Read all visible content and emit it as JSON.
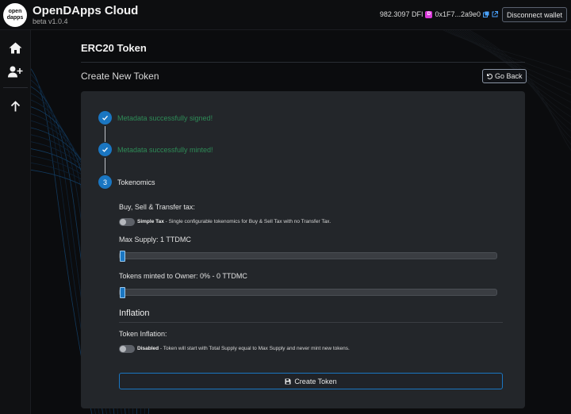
{
  "app": {
    "logo_text": "open dapps",
    "title": "OpenDApps Cloud",
    "version": "beta v1.0.4"
  },
  "wallet": {
    "balance": "982.3097 DFI",
    "dfi_icon": "dfi-token-icon",
    "address": "0x1F7...2a9e0",
    "disconnect_label": "Disconnect wallet"
  },
  "sidebar": {
    "items": [
      {
        "icon": "home-icon"
      },
      {
        "icon": "add-user-icon"
      },
      {
        "icon": "arrow-up-icon"
      }
    ]
  },
  "page": {
    "title": "ERC20 Token",
    "subtitle": "Create New Token",
    "go_back_label": "Go Back"
  },
  "steps": [
    {
      "label": "Metadata successfully signed!",
      "status": "done"
    },
    {
      "label": "Metadata successfully minted!",
      "status": "done"
    },
    {
      "number": "3",
      "label": "Tokenomics",
      "status": "active"
    }
  ],
  "tax": {
    "label": "Buy, Sell & Transfer tax:",
    "toggle_name": "Simple Tax",
    "toggle_desc": " - Single configurable tokenomics for Buy & Sell Tax with no Transfer Tax.",
    "enabled": false
  },
  "max_supply": {
    "label": "Max Supply:  1 TTDMC",
    "slider_fraction": 0
  },
  "owner_mint": {
    "label": "Tokens minted to Owner:  0% - 0 TTDMC",
    "slider_fraction": 0
  },
  "inflation": {
    "section_title": "Inflation",
    "label": "Token Inflation:",
    "toggle_name": "Disabled",
    "toggle_desc": " - Token will start with Total Supply equal to Max Supply and never mint new tokens.",
    "enabled": false
  },
  "create_button_label": "Create Token",
  "colors": {
    "accent": "#1a76c2",
    "success": "#2e8b57",
    "card": "#23262a",
    "background": "#0b0c0e"
  }
}
